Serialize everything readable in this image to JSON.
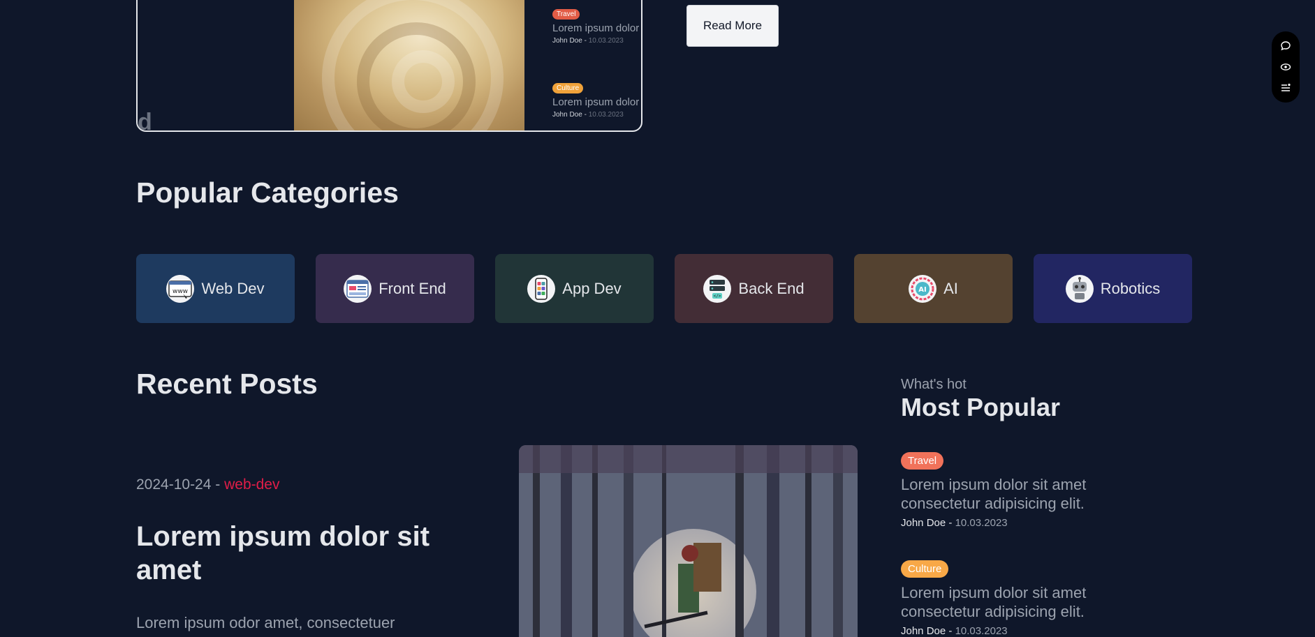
{
  "featured": {
    "cut_letter": "d",
    "side_posts": [
      {
        "badge": "Travel",
        "badge_color": "#e25c46",
        "title": "Lorem ipsum dolor sit amet consectetur adipisicing elit.",
        "author": "John Doe",
        "date": "10.03.2023"
      },
      {
        "badge": "Culture",
        "badge_color": "#f0a23a",
        "title": "Lorem ipsum dolor sit amet consectetur adipisicing elit.",
        "author": "John Doe",
        "date": "10.03.2023"
      }
    ]
  },
  "read_more_label": "Read More",
  "toolbar": {
    "icons": [
      "chat-bubble-icon",
      "eye-icon",
      "list-settings-icon"
    ]
  },
  "categories_heading": "Popular Categories",
  "categories": [
    {
      "label": "Web Dev",
      "color": "#1e3a5f",
      "icon": "www-icon"
    },
    {
      "label": "Front End",
      "color": "#362c4d",
      "icon": "browser-ui-icon"
    },
    {
      "label": "App Dev",
      "color": "#213537",
      "icon": "mobile-apps-icon"
    },
    {
      "label": "Back End",
      "color": "#432d36",
      "icon": "server-icon"
    },
    {
      "label": "AI",
      "color": "#544230",
      "icon": "ai-brain-icon"
    },
    {
      "label": "Robotics",
      "color": "#222662",
      "icon": "robot-icon"
    }
  ],
  "recent_posts": {
    "heading": "Recent Posts",
    "post": {
      "date": "2024-10-24",
      "separator": " - ",
      "category": "web-dev",
      "title": "Lorem ipsum dolor sit amet",
      "excerpt": "Lorem ipsum odor amet, consectetuer"
    }
  },
  "most_popular": {
    "eyebrow": "What's hot",
    "heading": "Most Popular",
    "posts": [
      {
        "badge": "Travel",
        "badge_color": "#f1725a",
        "title": "Lorem ipsum dolor sit amet consectetur adipisicing elit.",
        "author": "John Doe",
        "date": "10.03.2023"
      },
      {
        "badge": "Culture",
        "badge_color": "#f8a847",
        "title": "Lorem ipsum dolor sit amet consectetur adipisicing elit.",
        "author": "John Doe",
        "date": "10.03.2023"
      }
    ]
  }
}
